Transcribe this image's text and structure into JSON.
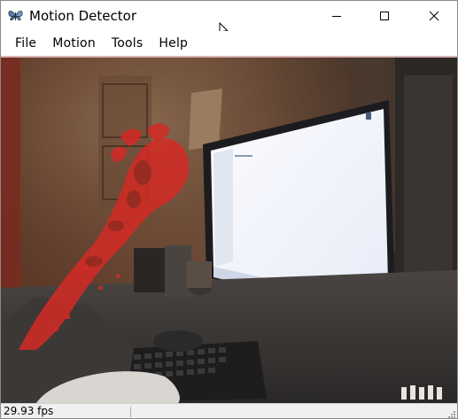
{
  "window": {
    "title": "Motion Detector"
  },
  "menu": {
    "items": [
      "File",
      "Motion",
      "Tools",
      "Help"
    ]
  },
  "status": {
    "fps": "29.93 fps"
  },
  "colors": {
    "motion_overlay": "#d42a24",
    "window_border": "#8a8a8a",
    "statusbar_bg": "#f0f0f0"
  },
  "icons": {
    "app": "butterfly-icon",
    "minimize": "minimize-icon",
    "maximize": "maximize-icon",
    "close": "close-icon",
    "cursor": "mouse-cursor-icon"
  }
}
